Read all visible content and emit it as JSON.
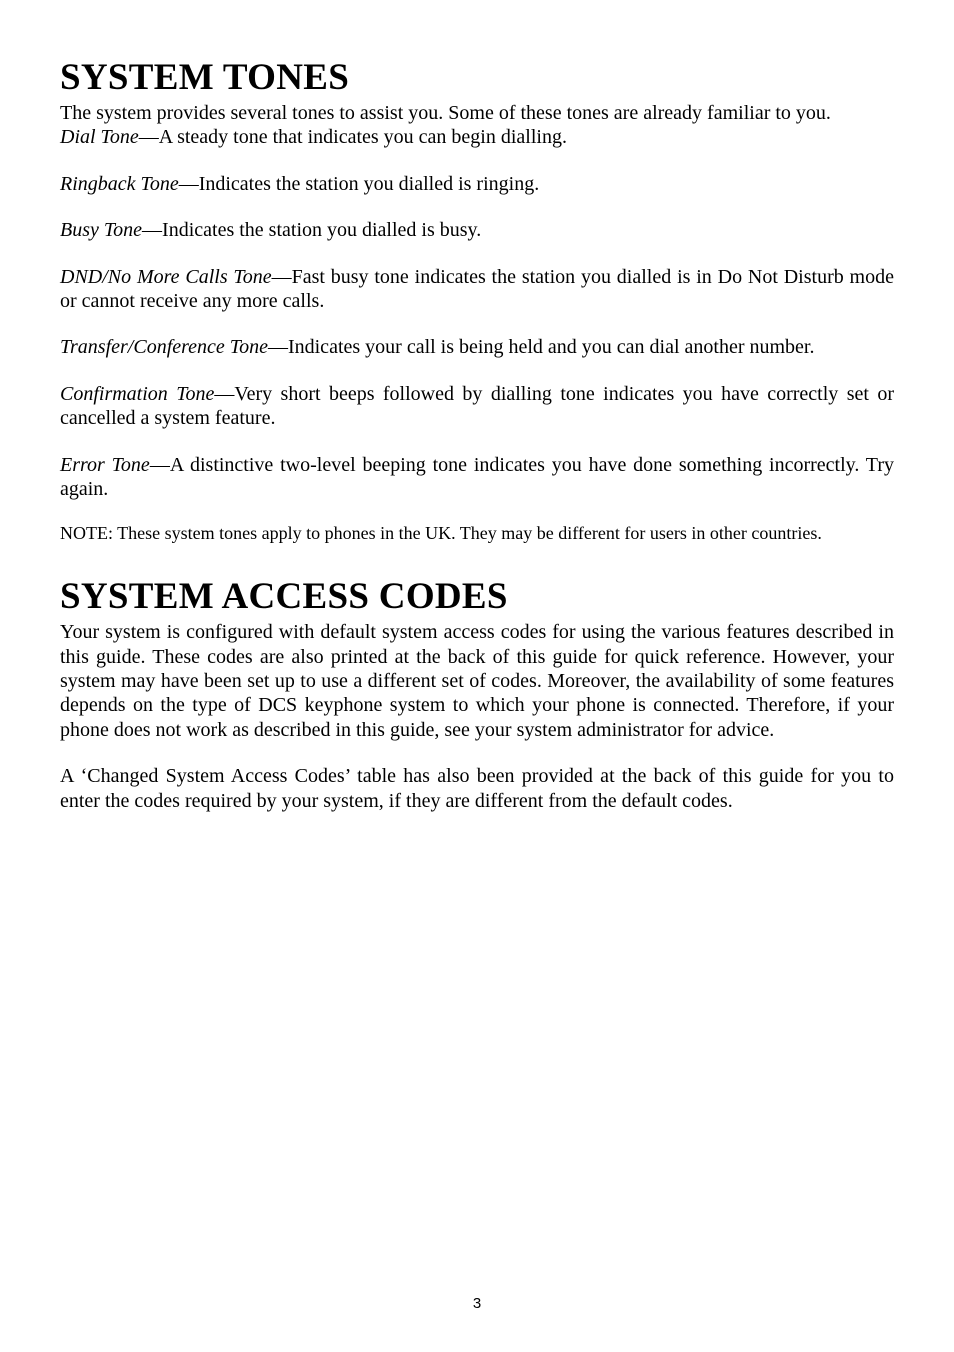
{
  "section1": {
    "heading": "SYSTEM TONES",
    "intro": "The system provides several tones to assist you. Some of these tones are already familiar to you.",
    "tones": [
      {
        "name": "Dial Tone",
        "desc": "—A steady tone that indicates you can begin dialling."
      },
      {
        "name": "Ringback Tone",
        "desc": "—Indicates the station you dialled is ringing."
      },
      {
        "name": "Busy Tone",
        "desc": "—Indicates the station you dialled is busy."
      },
      {
        "name": "DND/No More Calls Tone",
        "desc": "—Fast busy tone indicates the station you dialled is in Do Not Disturb mode or cannot receive any more calls."
      },
      {
        "name": "Transfer/Conference Tone",
        "desc": "—Indicates your call is being held and you can dial another number."
      },
      {
        "name": "Confirmation Tone",
        "desc": "—Very short beeps followed by dialling tone indicates you have correctly set or cancelled a system feature."
      },
      {
        "name": "Error Tone",
        "desc": "—A distinctive two-level beeping tone indicates you have done something incorrectly. Try again."
      }
    ],
    "note": "NOTE: These system tones apply to phones in the UK. They may be different for users in other countries."
  },
  "section2": {
    "heading": "SYSTEM ACCESS CODES",
    "para1": "Your system is configured with default system access codes for using the various features described in this guide. These codes are also printed at the back of this guide for quick reference. However, your system may have been set up to use a different set of codes. Moreover, the availability of some features depends on the type of DCS keyphone system to which your phone is connected. Therefore, if your phone does not work as described in this guide, see your system administrator for advice.",
    "para2": "A ‘Changed System Access Codes’ table has also been provided at the back of this guide for you to enter the codes required by your system, if they are different from the default codes."
  },
  "page_number": "3"
}
